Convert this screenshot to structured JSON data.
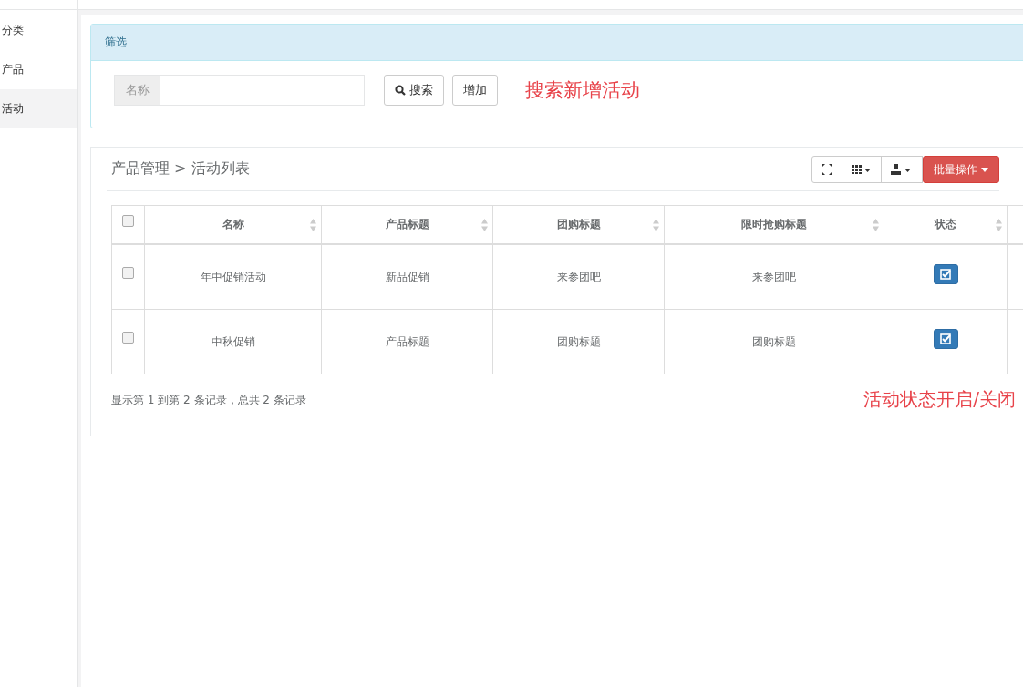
{
  "sidebar": {
    "items": [
      {
        "label": "分类",
        "selected": false
      },
      {
        "label": "产品",
        "selected": false
      },
      {
        "label": "活动",
        "selected": true
      }
    ]
  },
  "filter": {
    "title": "筛选",
    "field_label": "名称",
    "search_button": "搜索",
    "add_button": "增加",
    "annotation": "搜索新增活动"
  },
  "list": {
    "breadcrumb": "产品管理 > 活动列表",
    "batch_button": "批量操作",
    "table": {
      "select_all": false,
      "columns": [
        "名称",
        "产品标题",
        "团购标题",
        "限时抢购标题",
        "状态"
      ],
      "rows": [
        {
          "selected": false,
          "cells": [
            "年中促销活动",
            "新品促销",
            "来参团吧",
            "来参团吧"
          ],
          "status_on": true
        },
        {
          "selected": false,
          "cells": [
            "中秋促销",
            "产品标题",
            "团购标题",
            "团购标题"
          ],
          "status_on": true
        }
      ]
    },
    "footer": "显示第 1 到第 2 条记录，总共 2 条记录",
    "annotation": "活动状态开启/关闭"
  }
}
